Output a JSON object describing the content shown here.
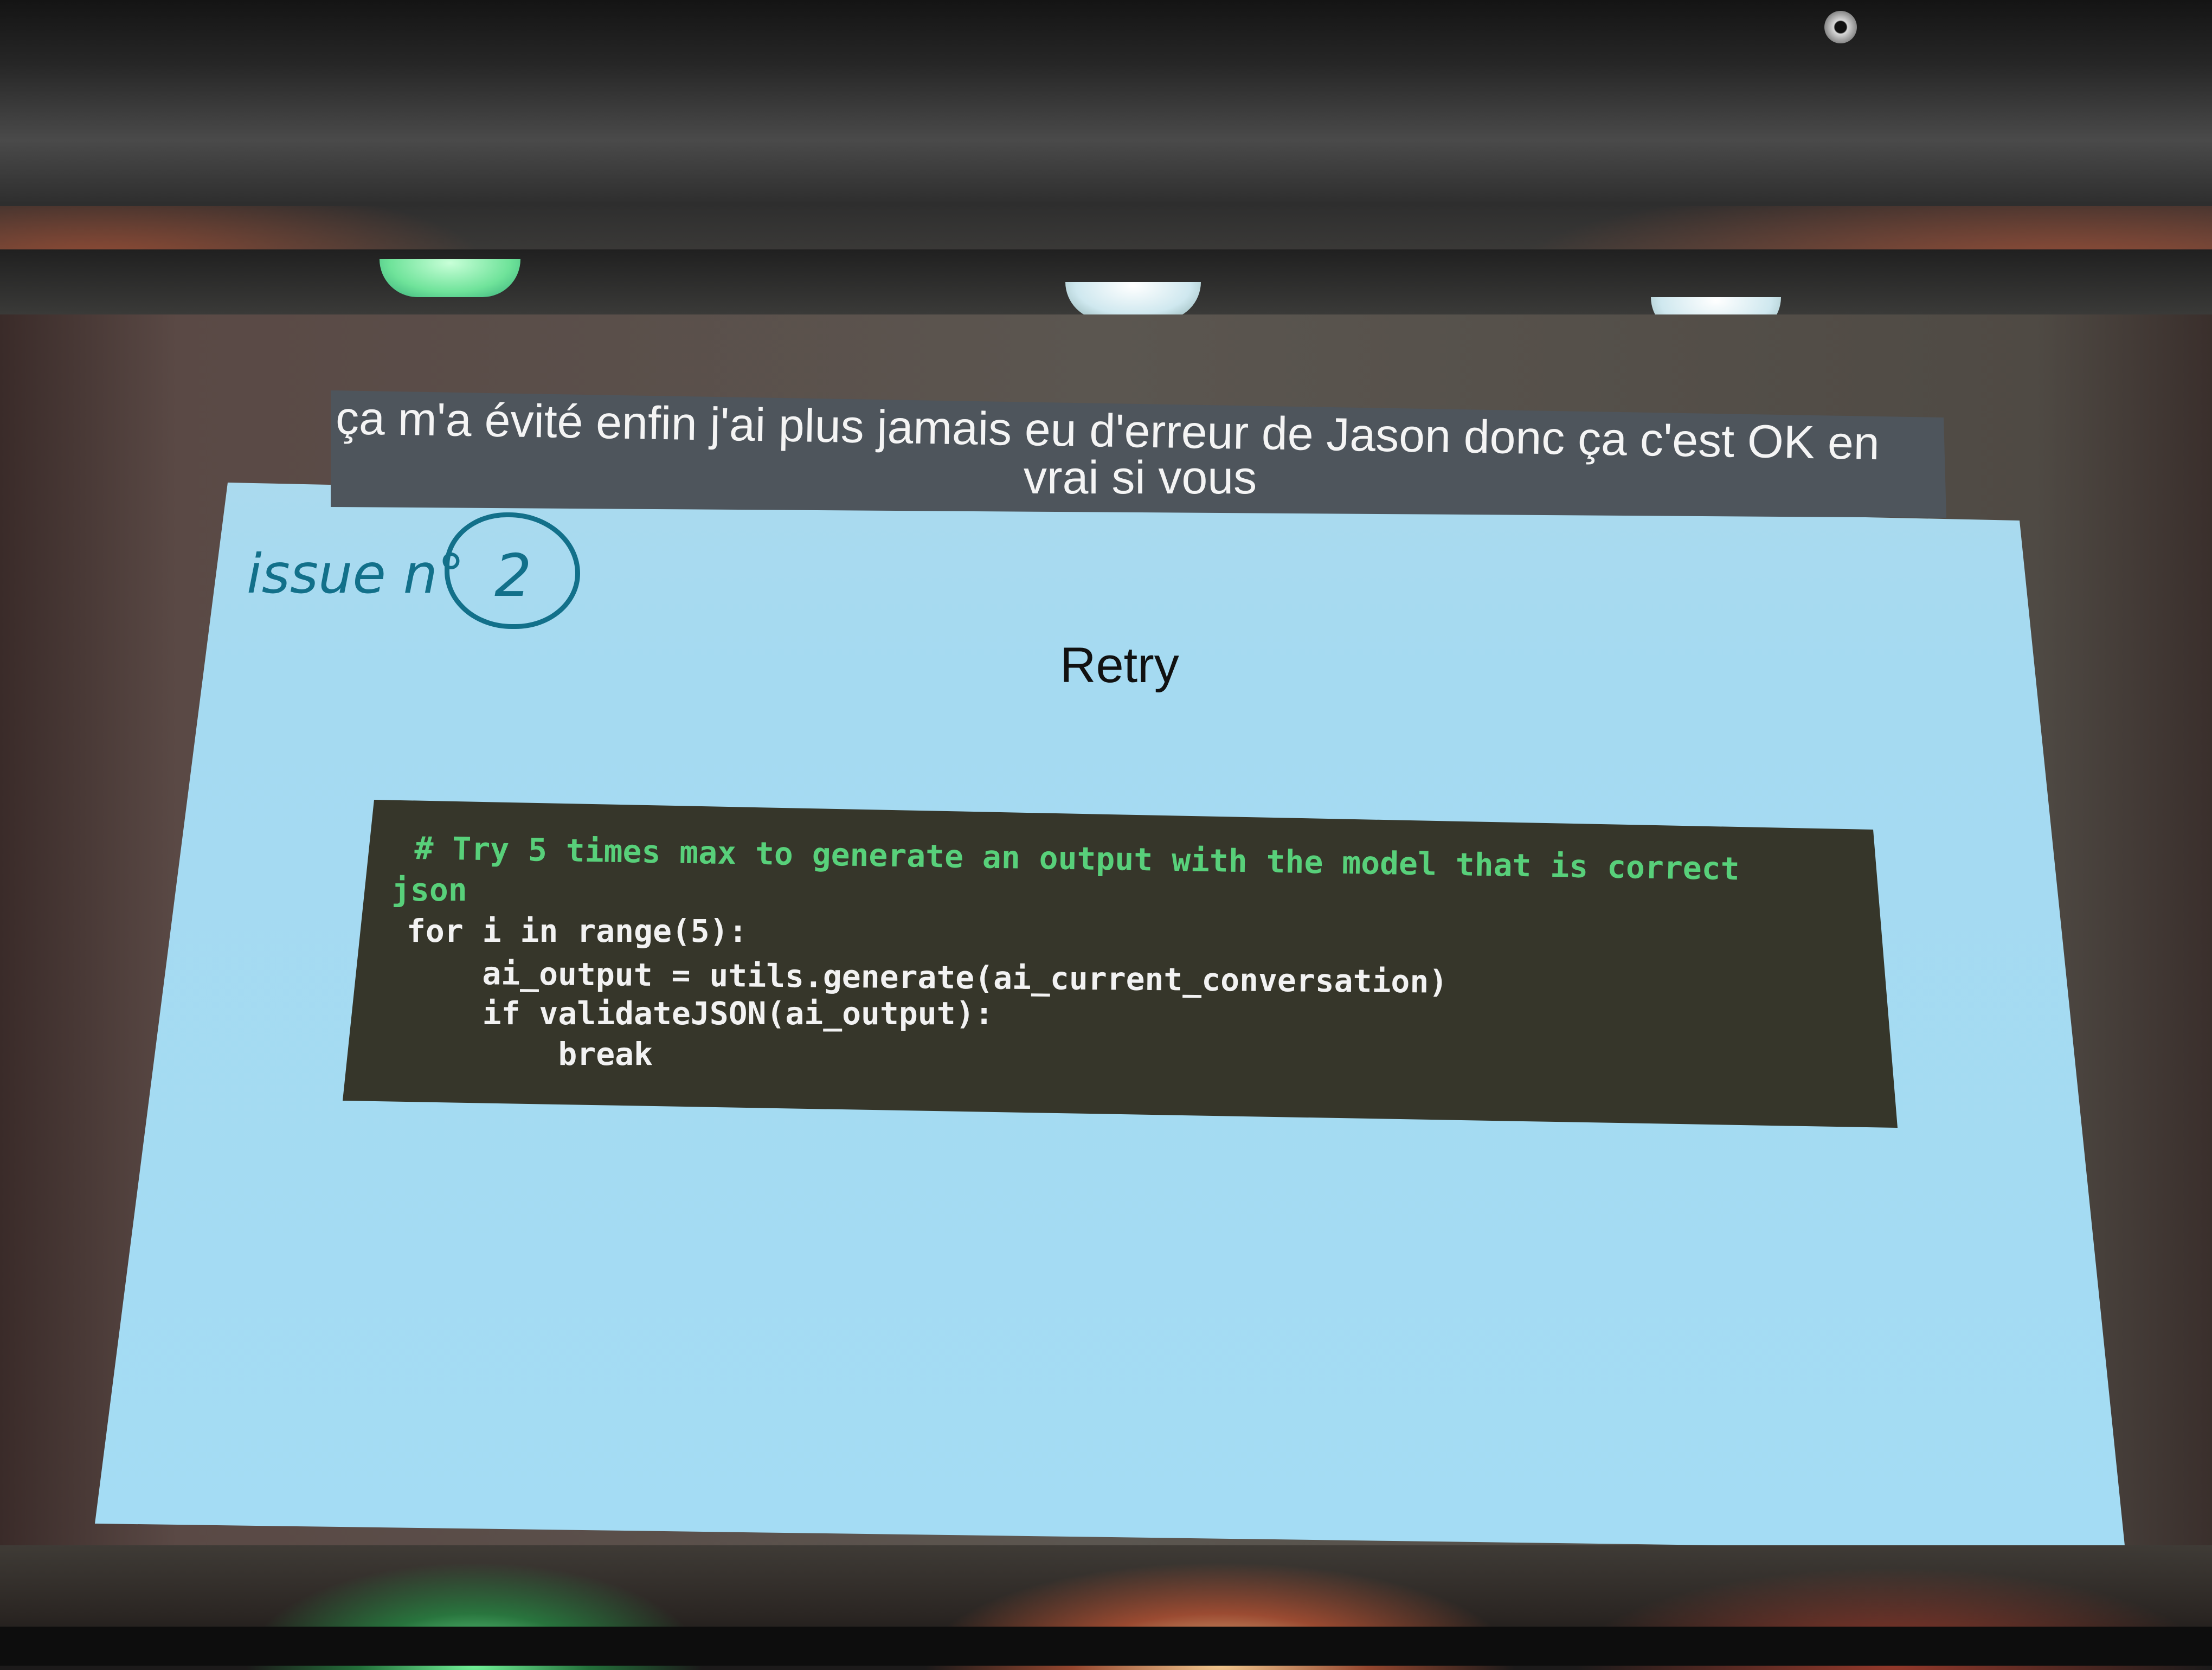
{
  "subtitle": {
    "line1": "ça m'a évité enfin j'ai plus jamais eu d'erreur de Jason donc ça c'est OK en",
    "line2": "vrai si vous"
  },
  "slide": {
    "issue_label": "issue n°",
    "issue_number": "2",
    "title": "Retry",
    "code": {
      "comment_line1": "# Try 5 times max to generate an output with the model that is correct",
      "comment_line2": "json",
      "line_for": "for i in range(5):",
      "line_assign": "    ai_output = utils.generate(ai_current_conversation)",
      "line_if": "    if validateJSON(ai_output):",
      "line_break": "        break"
    }
  },
  "colors": {
    "slide_background": "#a5daf1",
    "code_background": "#36362a",
    "code_comment": "#58d07a",
    "handwriting": "#12708a",
    "subtitle_bar": "#4e555c"
  }
}
